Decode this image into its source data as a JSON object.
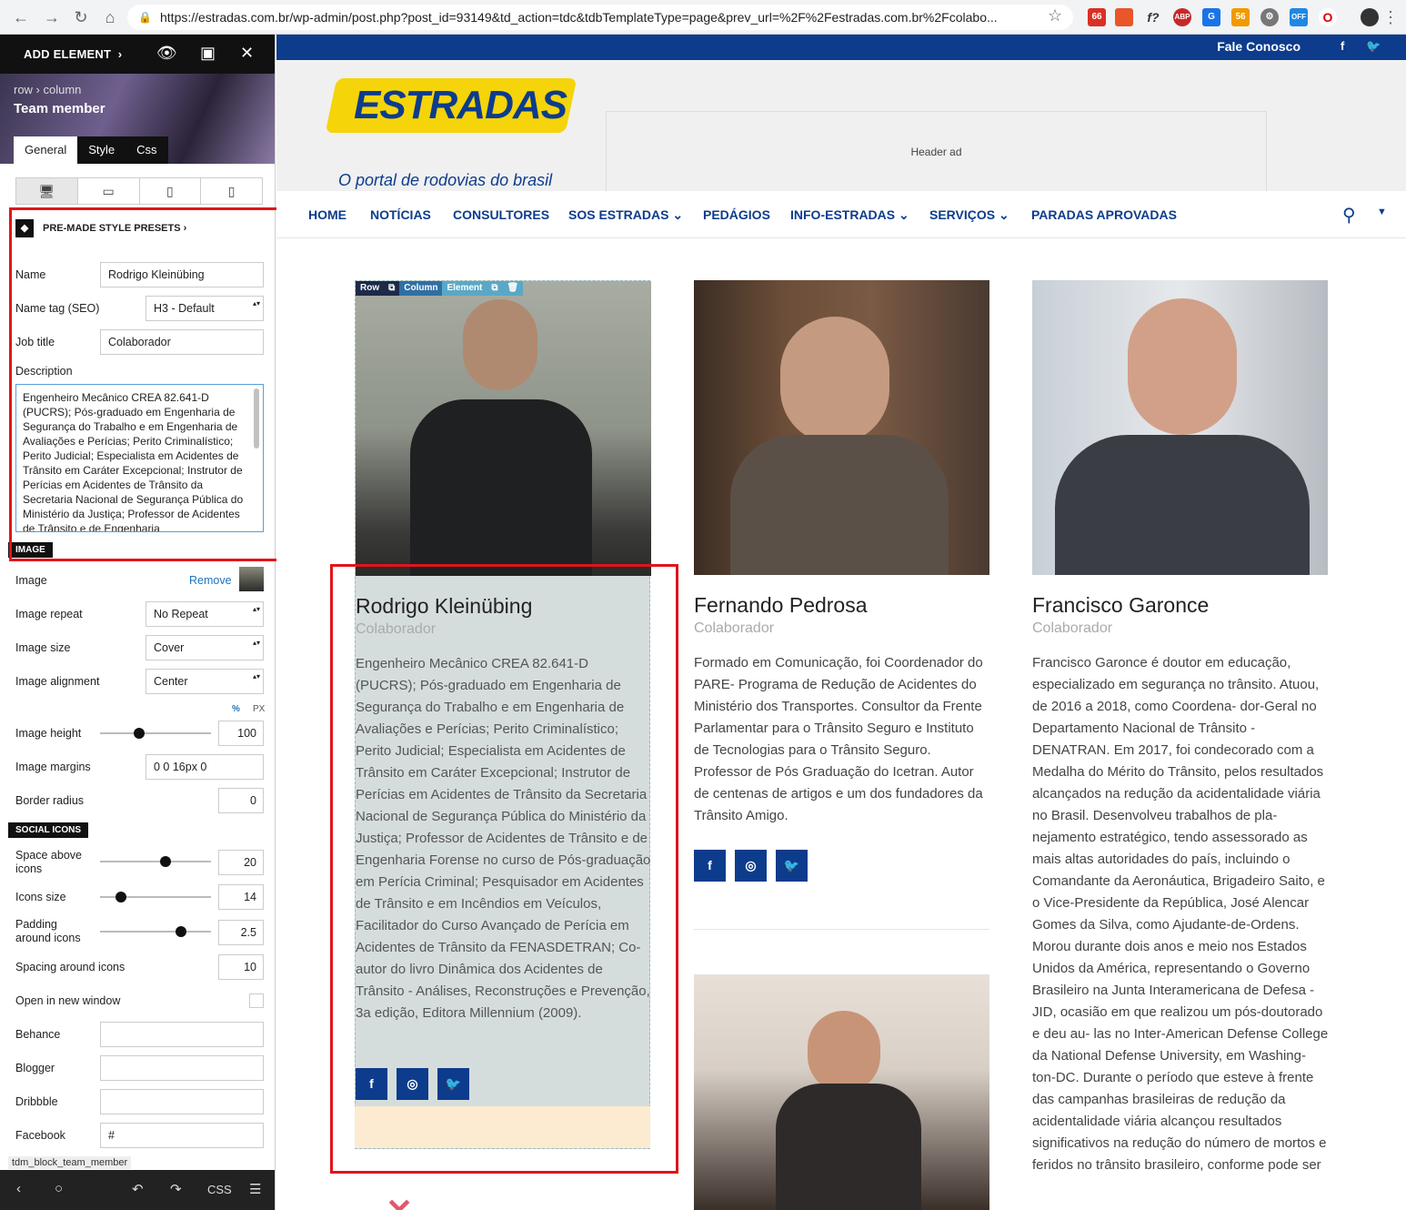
{
  "browser": {
    "url": "https://estradas.com.br/wp-admin/post.php?post_id=93149&td_action=tdc&tdbTemplateType=page&prev_url=%2F%2Festradas.com.br%2Fcolabo...",
    "ext_badges": [
      "66",
      "56",
      "OFF"
    ]
  },
  "panel": {
    "add_element": "ADD ELEMENT",
    "breadcrumb": "row › column",
    "title": "Team member",
    "tabs": [
      "General",
      "Style",
      "Css"
    ],
    "presets": "PRE-MADE STYLE PRESETS",
    "name_label": "Name",
    "name_value": "Rodrigo Kleinübing",
    "name_tag_label": "Name tag (SEO)",
    "name_tag_value": "H3 - Default",
    "job_label": "Job title",
    "job_value": "Colaborador",
    "desc_label": "Description",
    "desc_value": "Engenheiro Mecânico CREA 82.641-D (PUCRS); Pós-graduado em Engenharia de Segurança do Trabalho e em Engenharia de Avaliações e Perícias; Perito Criminalístico; Perito Judicial; Especialista em Acidentes de Trânsito em Caráter Excepcional; Instrutor de Perícias em Acidentes de Trânsito da Secretaria Nacional de Segurança Pública do Ministério da Justiça; Professor de Acidentes de Trânsito e de Engenharia",
    "image_section": "IMAGE",
    "image_label": "Image",
    "image_remove": "Remove",
    "image_repeat_label": "Image repeat",
    "image_repeat_value": "No Repeat",
    "image_size_label": "Image size",
    "image_size_value": "Cover",
    "image_align_label": "Image alignment",
    "image_align_value": "Center",
    "unit_pct": "%",
    "unit_px": "PX",
    "image_height_label": "Image height",
    "image_height_value": "100",
    "image_margins_label": "Image margins",
    "image_margins_value": "0 0 16px 0",
    "border_radius_label": "Border radius",
    "border_radius_value": "0",
    "social_section": "SOCIAL ICONS",
    "space_above_label": "Space above icons",
    "space_above_value": "20",
    "icons_size_label": "Icons size",
    "icons_size_value": "14",
    "padding_label": "Padding around icons",
    "padding_value": "2.5",
    "spacing_label": "Spacing around icons",
    "spacing_value": "10",
    "new_window_label": "Open in new window",
    "behance_label": "Behance",
    "blogger_label": "Blogger",
    "dribbble_label": "Dribbble",
    "facebook_label": "Facebook",
    "facebook_value": "#",
    "block_tag": "tdm_block_team_member",
    "bottom_css": "CSS"
  },
  "site": {
    "contact": "Fale Conosco",
    "logo_text": "ESTRADAS",
    "tagline": "O portal de rodovias do brasil",
    "header_ad": "Header ad",
    "menu": [
      "HOME",
      "NOTÍCIAS",
      "CONSULTORES",
      "SOS ESTRADAS",
      "PEDÁGIOS",
      "INFO-ESTRADAS",
      "SERVIÇOS",
      "PARADAS APROVADAS"
    ],
    "editor_bar": [
      "Row",
      "Column",
      "Element"
    ],
    "members": [
      {
        "name": "Rodrigo Kleinübing",
        "job": "Colaborador",
        "desc": "Engenheiro Mecânico CREA 82.641-D (PUCRS); Pós-graduado em Engenharia de Segurança do Trabalho e em Engenharia de Avaliações e Perícias; Perito Criminalístico; Perito Judicial; Especialista em Acidentes de Trânsito em Caráter Excepcional; Instrutor de Perícias em Acidentes de Trânsito da Secretaria Nacional de Segurança Pública do Ministério da Justiça; Professor de Acidentes de Trânsito e de Engenharia Forense no curso de Pós-graduação em Perícia Criminal; Pesquisador em Acidentes de Trânsito e em Incêndios em Veículos, Facilitador do Curso Avançado de Perícia em Acidentes de Trânsito da FENASDETRAN; Co-autor do livro Dinâmica dos Acidentes de Trânsito - Análises, Reconstruções e Prevenção, 3a edição, Editora Millennium (2009)."
      },
      {
        "name": "Fernando Pedrosa",
        "job": "Colaborador",
        "desc": "Formado em Comunicação, foi Coordenador do PARE- Programa de Redução de Acidentes do Ministério dos Transportes. Consultor da Frente Parlamentar para o Trânsito Seguro e Instituto de Tecnologias para o Trânsito Seguro. Professor de Pós Graduação do Icetran. Autor de centenas de artigos e um dos fundadores da Trânsito Amigo."
      },
      {
        "name": "Francisco Garonce",
        "job": "Colaborador",
        "desc": "Francisco Garonce é doutor em educação, especializado em segurança no trânsito. Atuou, de 2016 a 2018, como Coordena- dor-Geral no Departamento Nacional de Trânsito - DENATRAN. Em 2017, foi condecorado com a Medalha do Mérito do Trânsito, pelos resultados alcançados na redução da acidentalidade viária no Brasil. Desenvolveu trabalhos de pla- nejamento estratégico, tendo assessorado as mais altas autoridades do país, incluindo o Comandante da Aeronáutica, Brigadeiro Saito, e o Vice-Presidente da República, José Alencar Gomes da Silva, como Ajudante-de-Ordens. Morou durante dois anos e meio nos Estados Unidos da América, representando o Governo Brasileiro na Junta Interamericana de Defesa - JID, ocasião em que realizou um pós-doutorado e deu au- las no Inter-American Defense College da National Defense University, em Washing- ton-DC. Durante o período que esteve à frente das campanhas brasileiras de redução da acidentalidade viária alcançou resultados significativos na redução do número de mortos e feridos no trânsito brasileiro, conforme pode ser"
      }
    ]
  }
}
